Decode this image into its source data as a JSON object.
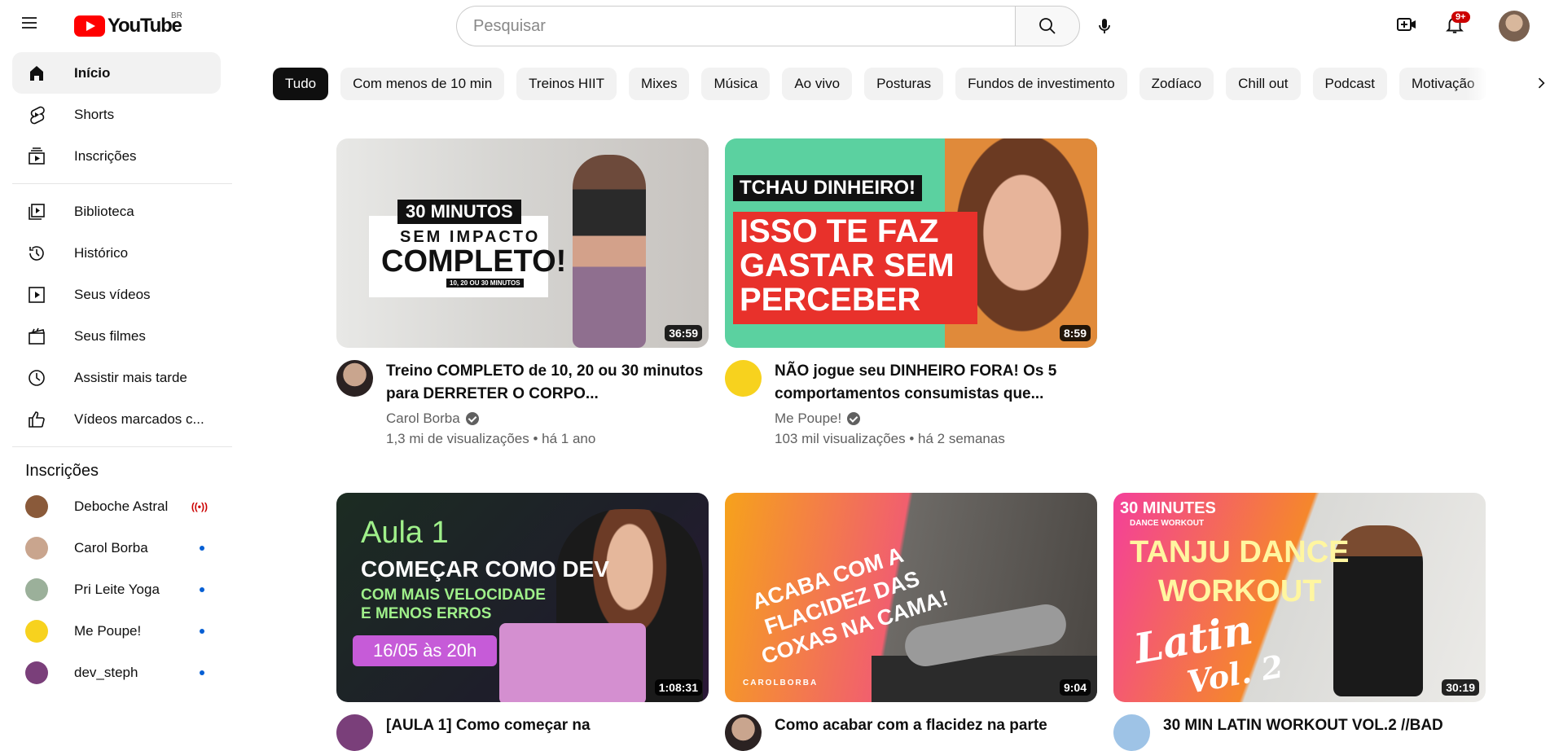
{
  "header": {
    "logo_text": "YouTube",
    "country": "BR",
    "search_placeholder": "Pesquisar",
    "notification_badge": "9+"
  },
  "sidebar": {
    "main": [
      {
        "label": "Início",
        "icon": "home-icon",
        "active": true
      },
      {
        "label": "Shorts",
        "icon": "shorts-icon"
      },
      {
        "label": "Inscrições",
        "icon": "subscriptions-icon"
      }
    ],
    "library": [
      {
        "label": "Biblioteca",
        "icon": "library-icon"
      },
      {
        "label": "Histórico",
        "icon": "history-icon"
      },
      {
        "label": "Seus vídeos",
        "icon": "your-videos-icon"
      },
      {
        "label": "Seus filmes",
        "icon": "movies-icon"
      },
      {
        "label": "Assistir mais tarde",
        "icon": "watch-later-icon"
      },
      {
        "label": "Vídeos marcados c...",
        "icon": "like-icon"
      }
    ],
    "subscriptions_heading": "Inscrições",
    "subscriptions": [
      {
        "label": "Deboche Astral",
        "status": "live",
        "avatar_color": "#8a5a3a"
      },
      {
        "label": "Carol Borba",
        "status": "new",
        "avatar_color": "#c9a58e"
      },
      {
        "label": "Pri Leite Yoga",
        "status": "new",
        "avatar_color": "#9bb09a"
      },
      {
        "label": "Me Poupe!",
        "status": "new",
        "avatar_color": "#f7d21e"
      },
      {
        "label": "dev_steph",
        "status": "new",
        "avatar_color": "#7a3f7a"
      }
    ]
  },
  "chips": [
    "Tudo",
    "Com menos de 10 min",
    "Treinos HIIT",
    "Mixes",
    "Música",
    "Ao vivo",
    "Posturas",
    "Fundos de investimento",
    "Zodíaco",
    "Chill out",
    "Podcast",
    "Motivação"
  ],
  "videos": [
    {
      "title": "Treino COMPLETO de 10, 20 ou 30 minutos para DERRETER O CORPO...",
      "channel": "Carol Borba",
      "verified": true,
      "stats": "1,3 mi de visualizações • há 1 ano",
      "duration": "36:59",
      "thumb_text": [
        "30 MINUTOS",
        "SEM IMPACTO",
        "COMPLETO!",
        "10, 20 OU 30 MINUTOS"
      ]
    },
    {
      "title": "NÃO jogue seu DINHEIRO FORA! Os 5 comportamentos consumistas que...",
      "channel": "Me Poupe!",
      "verified": true,
      "stats": "103 mil visualizações • há 2 semanas",
      "duration": "8:59",
      "thumb_text": [
        "TCHAU DINHEIRO!",
        "ISSO TE FAZ",
        "GASTAR SEM",
        "PERCEBER"
      ]
    },
    {
      "title": "[AULA 1] Como começar na",
      "duration": "1:08:31",
      "thumb_text": [
        "Aula 1",
        "COMEÇAR COMO DEV",
        "COM MAIS VELOCIDADE",
        "E MENOS ERROS",
        "16/05 às 20h"
      ]
    },
    {
      "title": "Como acabar com a flacidez na parte",
      "duration": "9:04",
      "thumb_text": [
        "ACABA COM A",
        "FLACIDEZ DAS",
        "COXAS NA CAMA!",
        "CAROLBORBA"
      ]
    },
    {
      "title": "30 MIN LATIN WORKOUT VOL.2 //BAD",
      "duration": "30:19",
      "thumb_text": [
        "30 MINUTES",
        "DANCE WORKOUT",
        "TANJU DANCE",
        "WORKOUT",
        "Latin",
        "Vol. 2"
      ]
    }
  ]
}
